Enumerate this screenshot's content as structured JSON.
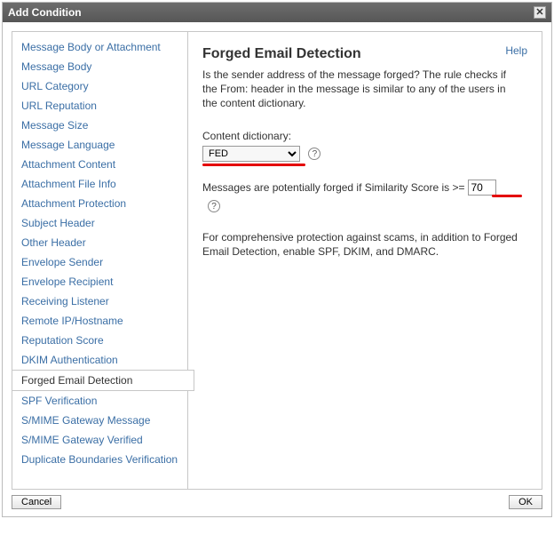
{
  "window": {
    "title": "Add Condition"
  },
  "sidebar": {
    "items": [
      "Message Body or Attachment",
      "Message Body",
      "URL Category",
      "URL Reputation",
      "Message Size",
      "Message Language",
      "Attachment Content",
      "Attachment File Info",
      "Attachment Protection",
      "Subject Header",
      "Other Header",
      "Envelope Sender",
      "Envelope Recipient",
      "Receiving Listener",
      "Remote IP/Hostname",
      "Reputation Score",
      "DKIM Authentication",
      "Forged Email Detection",
      "SPF Verification",
      "S/MIME Gateway Message",
      "S/MIME Gateway Verified",
      "Duplicate Boundaries Verification"
    ],
    "selected_index": 17
  },
  "main": {
    "help_label": "Help",
    "heading": "Forged Email Detection",
    "description": "Is the sender address of the message forged? The rule checks if the From: header in the message is similar to any of the users in the content dictionary.",
    "content_dictionary_label": "Content dictionary:",
    "content_dictionary_value": "FED",
    "similarity_text": "Messages are potentially forged if Similarity Score is >=",
    "similarity_value": "70",
    "note": "For comprehensive protection against scams, in addition to Forged Email Detection, enable SPF, DKIM, and DMARC."
  },
  "footer": {
    "cancel": "Cancel",
    "ok": "OK"
  }
}
